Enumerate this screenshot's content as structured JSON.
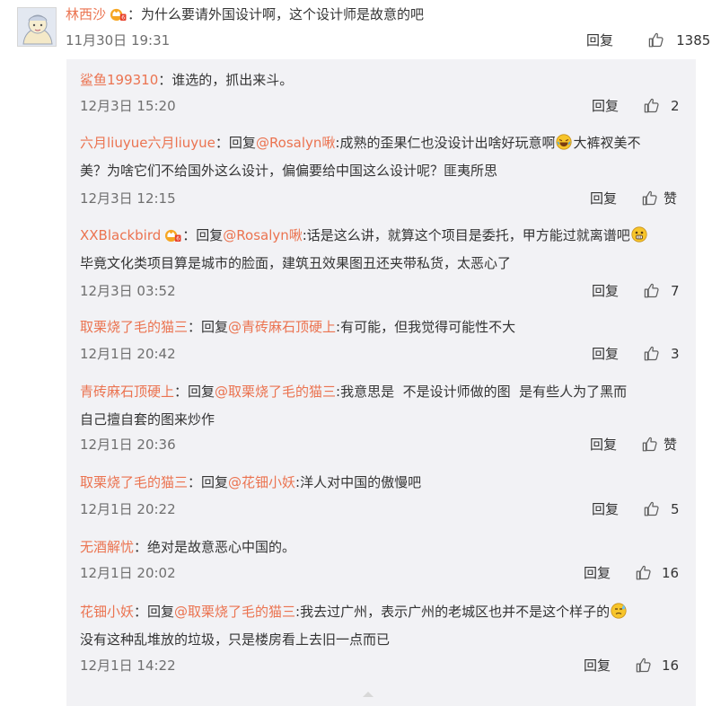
{
  "main_comment": {
    "author": "林西沙",
    "text": "：为什么要请外国设计啊，这个设计师是故意的吧",
    "time": "11月30日 19:31",
    "reply_label": "回复",
    "likes": "1385"
  },
  "replies": [
    {
      "author": "鲨鱼199310",
      "parts": [
        "：谁选的，抓出来斗。"
      ],
      "time": "12月3日 15:20",
      "reply_label": "回复",
      "likes": "2"
    },
    {
      "author": "六月liuyue六月liuyue",
      "prefix": "：回复",
      "mention": "@Rosalyn啾",
      "line1": ":成熟的歪果仁也没设计出啥好玩意啊",
      "line1_tail": "大裤衩美不",
      "line2": "美？为啥它们不给国外这么设计，偏偏要给中国这么设计呢？匪夷所思",
      "time": "12月3日 12:15",
      "reply_label": "回复",
      "likes": "赞"
    },
    {
      "author": "XXBlackbird",
      "prefix": "：回复",
      "mention": "@Rosalyn啾",
      "line1": ":话是这么讲，就算这个项目是委托，甲方能过就离谱吧",
      "line2": "毕竟文化类项目算是城市的脸面，建筑丑效果图丑还夹带私货，太恶心了",
      "time": "12月3日 03:52",
      "reply_label": "回复",
      "likes": "7"
    },
    {
      "author": "取栗烧了毛的猫三",
      "prefix": "：回复",
      "mention": "@青砖麻石顶硬上",
      "line1": ":有可能，但我觉得可能性不大",
      "time": "12月1日 20:42",
      "reply_label": "回复",
      "likes": "3"
    },
    {
      "author": "青砖麻石顶硬上",
      "prefix": "：回复",
      "mention": "@取栗烧了毛的猫三",
      "line1": ":我意思是  不是设计师做的图  是有些人为了黑而",
      "line2": "自己擅自套的图来炒作",
      "time": "12月1日 20:36",
      "reply_label": "回复",
      "likes": "赞"
    },
    {
      "author": "取栗烧了毛的猫三",
      "prefix": "：回复",
      "mention": "@花钿小妖",
      "line1": ":洋人对中国的傲慢吧",
      "time": "12月1日 20:22",
      "reply_label": "回复",
      "likes": "5"
    },
    {
      "author": "无酒解忧",
      "line1": "：绝对是故意恶心中国的。",
      "time": "12月1日 20:02",
      "reply_label": "回复",
      "likes": "16"
    },
    {
      "author": "花钿小妖",
      "prefix": "：回复",
      "mention": "@取栗烧了毛的猫三",
      "line1": ":我去过广州，表示广州的老城区也并不是这个样子的",
      "line2": "没有这种乱堆放的垃圾，只是楼房看上去旧一点而已",
      "time": "12月1日 14:22",
      "reply_label": "回复",
      "likes": "16"
    }
  ],
  "icons": {
    "thumb": "thumb-up-icon",
    "crown_badge": "member-crown-icon",
    "emoji_laugh": "laugh-cry-emoji",
    "emoji_shock": "shocked-emoji",
    "emoji_sweat": "sweat-emoji"
  },
  "colors": {
    "accent": "#eb7350",
    "reply_bg": "#f2f2f5",
    "meta": "#6f6f6f"
  }
}
